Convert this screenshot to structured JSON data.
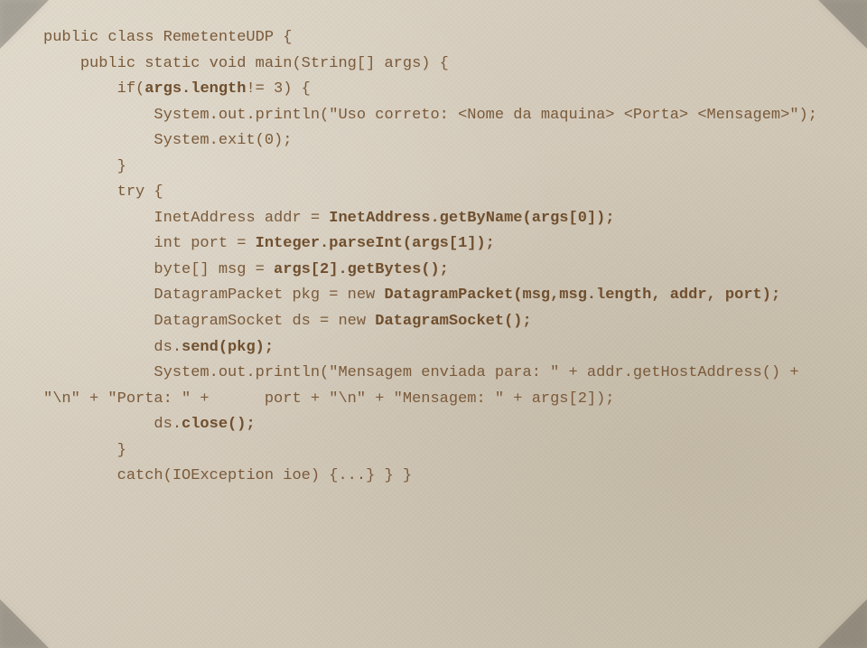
{
  "code": {
    "l1": "public class RemetenteUDP {",
    "l2a": "    public static void main(String[] args) {",
    "l3a": "        if(",
    "l3b": "args.length",
    "l3c": "!= 3) {",
    "l4": "            System.out.println(\"Uso correto: <Nome da maquina> <Porta> <Mensagem>\");",
    "l5": "            System.exit(0);",
    "l6": "        }",
    "l7": "        try {",
    "l8a": "            InetAddress addr = ",
    "l8b": "InetAddress.getByName(args[0]);",
    "l9a": "            int port = ",
    "l9b": "Integer.parseInt(args[1]);",
    "l10a": "            byte[] msg = ",
    "l10b": "args[2].getBytes();",
    "l11a": "            DatagramPacket pkg = new ",
    "l11b": "DatagramPacket(msg,msg.length, addr, port);",
    "l12a": "            DatagramSocket ds = new ",
    "l12b": "DatagramSocket();",
    "l13": "            ds.",
    "l13b": "send(pkg);",
    "l14": "            System.out.println(\"Mensagem enviada para: \" + addr.getHostAddress() + \"\\n\" + \"Porta: \" +      port + \"\\n\" + \"Mensagem: \" + args[2]);",
    "l15a": "            ds.",
    "l15b": "close();",
    "l16": "        }",
    "l17": "        catch(IOException ioe) {...} } }"
  }
}
